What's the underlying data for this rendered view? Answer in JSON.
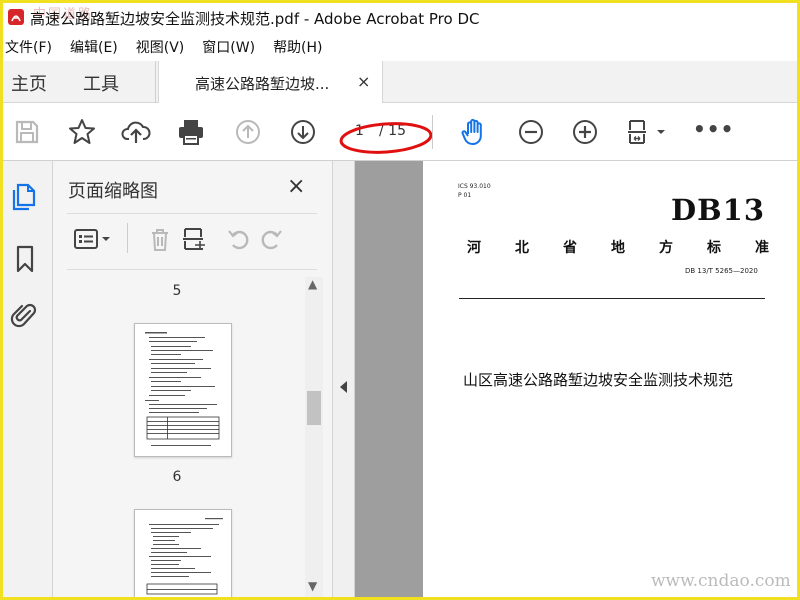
{
  "window": {
    "title": "高速公路路堑边坡安全监测技术规范.pdf - Adobe Acrobat Pro DC",
    "watermark_top": "中国道路"
  },
  "menu": {
    "items": [
      "文件(F)",
      "编辑(E)",
      "视图(V)",
      "窗口(W)",
      "帮助(H)"
    ]
  },
  "tabs": {
    "home": "主页",
    "tools": "工具",
    "document": "高速公路路堑边坡...",
    "close_glyph": "×"
  },
  "toolbar": {
    "page_current": "1",
    "page_total": "/ 15",
    "more": "•••",
    "icons": [
      "save-icon",
      "star-icon",
      "cloud-upload-icon",
      "print-icon",
      "prev-page-icon",
      "next-page-icon",
      "hand-icon",
      "zoom-out-icon",
      "zoom-in-icon",
      "fit-page-icon"
    ],
    "accent_color": "#1473e6",
    "annotation_color": "#e01010"
  },
  "rail": {
    "icons": [
      "pages-icon",
      "bookmark-icon",
      "attachment-icon"
    ]
  },
  "thumbnail_panel": {
    "title": "页面缩略图",
    "close_glyph": "×",
    "pages": [
      {
        "number": "5"
      },
      {
        "number": "6"
      }
    ],
    "scroll_up": "▲",
    "scroll_down": "▼"
  },
  "document": {
    "ics": "ICS 93.010",
    "pcode": "P 01",
    "brand": "DB13",
    "standard_title_chars": [
      "河",
      "北",
      "省",
      "地",
      "方",
      "标",
      "准"
    ],
    "standard_number": "DB 13/T 5265—2020",
    "heading": "山区高速公路路堑边坡安全监测技术规范"
  },
  "watermark_bottom": "www.cndao.com"
}
